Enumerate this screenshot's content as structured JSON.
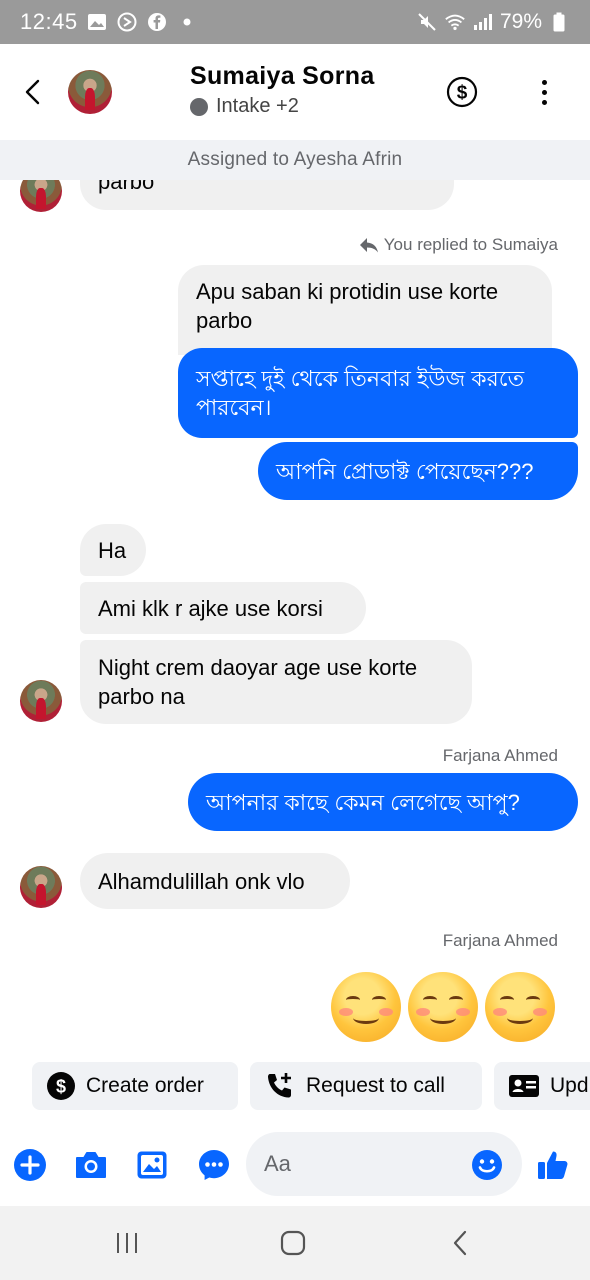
{
  "status_bar": {
    "time": "12:45",
    "battery": "79%"
  },
  "header": {
    "name": "Sumaiya Sorna",
    "subtitle": "Intake +2"
  },
  "assigned": "Assigned to Ayesha Afrin",
  "messages": {
    "m0": "parbo",
    "reply_meta": "You replied to Sumaiya",
    "quoted": "Apu saban ki protidin use korte parbo",
    "out1": "সপ্তাহে দুই থেকে তিনবার ইউজ করতে পারবেন।",
    "out2": "আপনি প্রোডাক্ট পেয়েছেন???",
    "in1": "Ha",
    "in2": "Ami klk r ajke use korsi",
    "in3": "Night crem daoyar age use korte parbo na",
    "sender1": "Farjana Ahmed",
    "out3": "আপনার কাছে কেমন লেগেছে আপু?",
    "in4": "Alhamdulillah onk vlo",
    "sender2": "Farjana Ahmed"
  },
  "quick_actions": {
    "create_order": "Create order",
    "request_call": "Request to call",
    "update": "Upd"
  },
  "composer": {
    "placeholder": "Aa"
  },
  "colors": {
    "accent": "#0866ff",
    "incoming_bubble": "#f0f0f0"
  }
}
